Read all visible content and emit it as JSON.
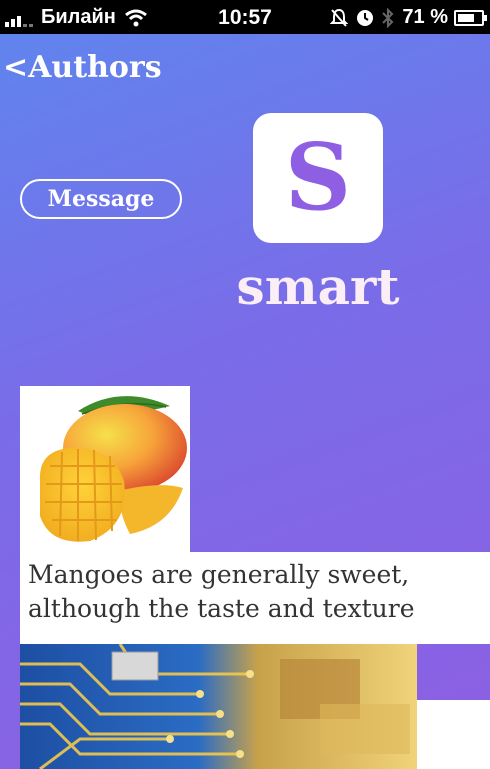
{
  "status_bar": {
    "carrier": "Билайн",
    "time": "10:57",
    "battery": "71 %",
    "battery_level": 0.71,
    "icons": [
      "signal-icon",
      "wifi-icon",
      "mute-icon",
      "alarm-icon",
      "bluetooth-icon",
      "battery-icon"
    ]
  },
  "nav": {
    "back_label": "<Authors"
  },
  "profile": {
    "avatar_letter": "S",
    "name": "smart",
    "message_label": "Message"
  },
  "posts": [
    {
      "image": "mango-photo",
      "text": "Mangoes are generally sweet, although the taste and texture"
    },
    {
      "image": "circuit-board-photo"
    }
  ],
  "colors": {
    "gradient_top": "#5e86ee",
    "gradient_bottom": "#8d5fe2",
    "avatar_letter": "#8e5fe3"
  }
}
